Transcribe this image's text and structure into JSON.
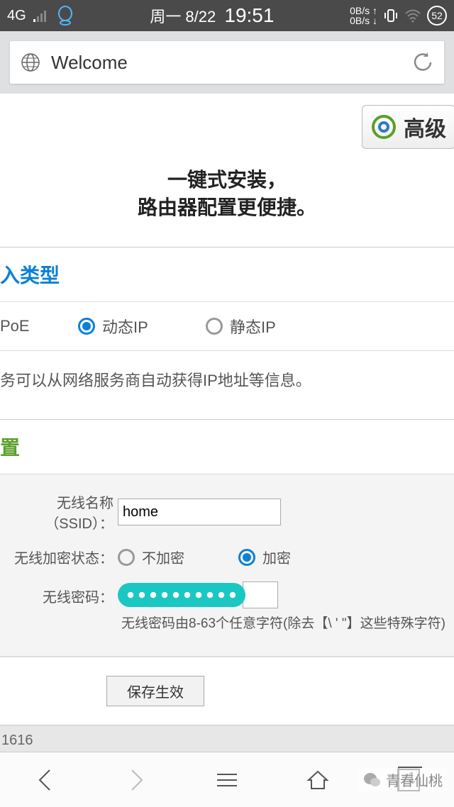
{
  "status": {
    "network": "4G",
    "date": "周一 8/22",
    "time": "19:51",
    "speed_up": "0B/s",
    "speed_down": "0B/s",
    "battery": "52"
  },
  "browser": {
    "title": "Welcome"
  },
  "page": {
    "advanced_label": "高级",
    "slogan_line1": "一键式安装，",
    "slogan_line2": "路由器配置更便捷。",
    "access_type_title": "入类型",
    "radio_poe": "PoE",
    "radio_dynamic": "动态IP",
    "radio_static": "静态IP",
    "dynamic_hint": "务可以从网络服务商自动获得IP地址等信息。",
    "wireless_title": "置",
    "ssid_label": "无线名称（SSID）：",
    "ssid_value": "home",
    "encrypt_label": "无线加密状态：",
    "encrypt_off": "不加密",
    "encrypt_on": "加密",
    "pwd_label": "无线密码：",
    "pwd_hint": "无线密码由8-63个任意字符(除去【\\ ' \"】这些特殊字符)",
    "save_label": "保存生效",
    "footer": "1616"
  },
  "nav": {
    "tab_count": "1"
  },
  "watermark": "青春仙桃"
}
